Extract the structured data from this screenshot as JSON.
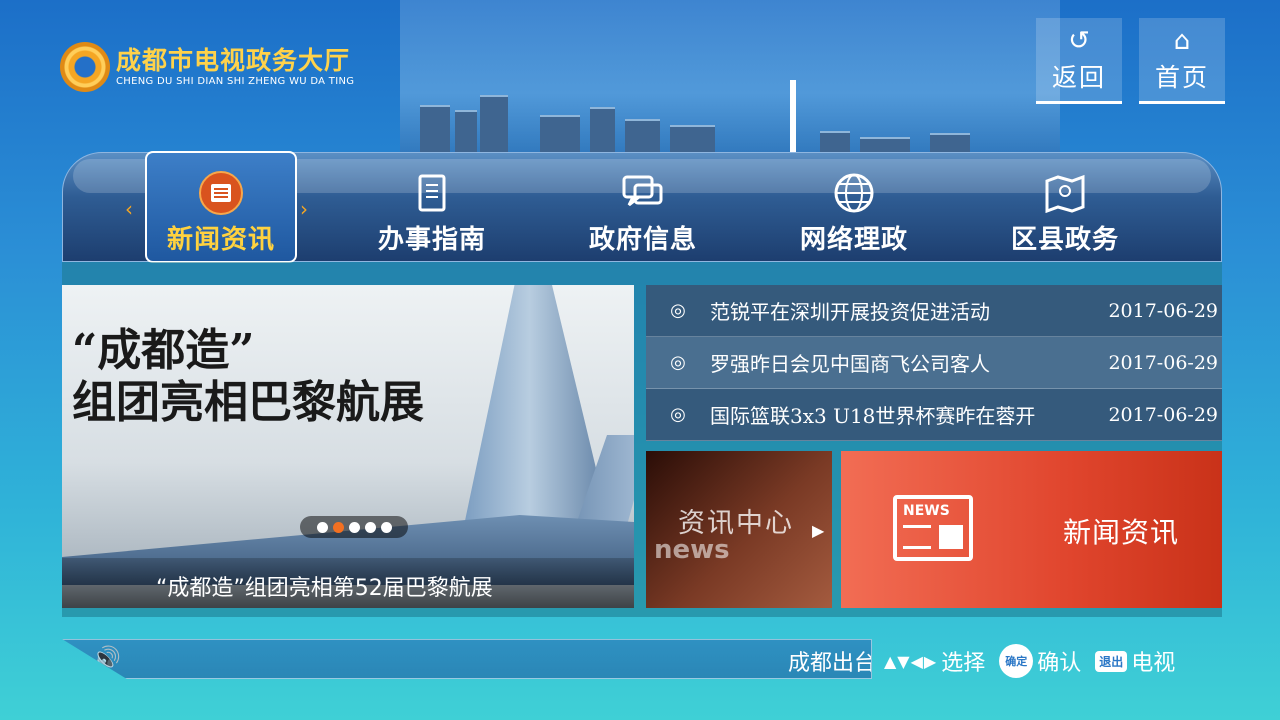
{
  "header": {
    "logo_cn": "成都市电视政务大厅",
    "logo_en": "CHENG DU  SHI  DIAN  SHI ZHENG WU DA TING",
    "back_label": "返回",
    "home_label": "首页"
  },
  "nav": {
    "items": [
      {
        "label": "新闻资讯",
        "icon": "news-icon"
      },
      {
        "label": "办事指南",
        "icon": "notebook-icon"
      },
      {
        "label": "政府信息",
        "icon": "chat-icon"
      },
      {
        "label": "网络理政",
        "icon": "globe-icon"
      },
      {
        "label": "区县政务",
        "icon": "map-icon"
      }
    ],
    "active_index": 0
  },
  "feature": {
    "title_line1": "“成都造”",
    "title_line2": "组团亮相巴黎航展",
    "caption": "“成都造”组团亮相第52届巴黎航展",
    "slide_count": 5,
    "active_slide": 2
  },
  "news": [
    {
      "title": "范锐平在深圳开展投资促进活动",
      "date": "2017-06-29"
    },
    {
      "title": "罗强昨日会见中国商飞公司客人",
      "date": "2017-06-29"
    },
    {
      "title": "国际篮联3x3 U18世界杯赛昨在蓉开",
      "date": "2017-06-29"
    }
  ],
  "tiles": {
    "center_title": "资讯中心",
    "center_sub": "news",
    "news_tag": "NEWS",
    "news_label": "新闻资讯"
  },
  "footer": {
    "ticker": "成都出台",
    "hint_select": "选择",
    "hint_confirm_key": "确定",
    "hint_confirm": "确认",
    "hint_exit_key": "退出",
    "hint_exit": "电视"
  },
  "colors": {
    "accent_gold": "#ffd23f",
    "active_dot": "#f37021",
    "news_tile": "#e0452d"
  }
}
